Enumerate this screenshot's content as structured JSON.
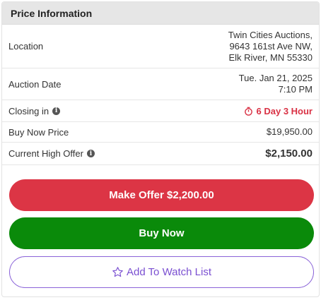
{
  "header": {
    "title": "Price Information"
  },
  "rows": {
    "location": {
      "label": "Location",
      "line1": "Twin Cities Auctions,",
      "line2": "9643 161st Ave NW,",
      "line3": "Elk River, MN 55330"
    },
    "auction_date": {
      "label": "Auction Date",
      "line1": "Tue. Jan 21, 2025",
      "line2": "7:10 PM"
    },
    "closing": {
      "label": "Closing in",
      "value": "6 Day 3 Hour"
    },
    "buy_now": {
      "label": "Buy Now Price",
      "value": "$19,950.00"
    },
    "high_offer": {
      "label": "Current High Offer",
      "value": "$2,150.00"
    }
  },
  "buttons": {
    "make_offer": "Make Offer $2,200.00",
    "buy_now": "Buy Now",
    "watch_list": "Add To Watch List"
  },
  "colors": {
    "red": "#dc3545",
    "green": "#0a8a0a",
    "purple": "#7a4fd1"
  },
  "icons": {
    "info": "info-icon",
    "timer": "stopwatch-icon",
    "star": "star-icon"
  }
}
